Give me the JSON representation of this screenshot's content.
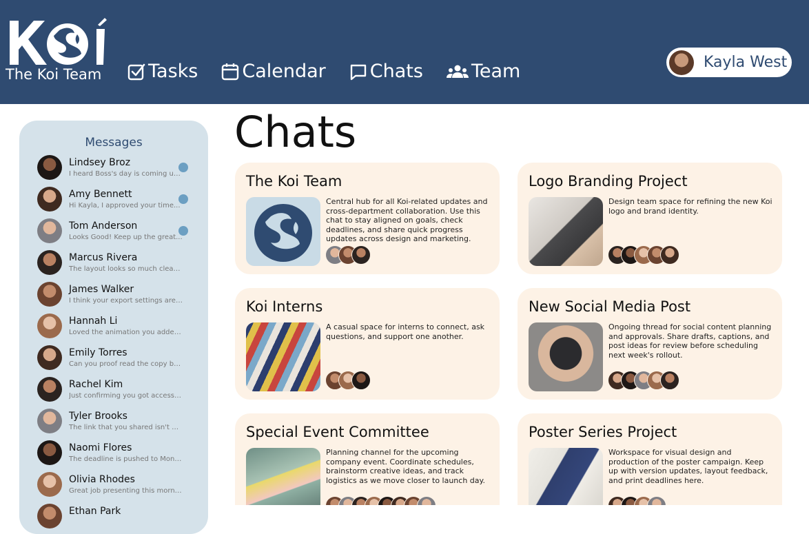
{
  "brand": {
    "name": "The Koi Team"
  },
  "nav": {
    "items": [
      {
        "label": "Tasks",
        "icon": "check-square-icon"
      },
      {
        "label": "Calendar",
        "icon": "calendar-icon"
      },
      {
        "label": "Chats",
        "icon": "chat-bubble-icon"
      },
      {
        "label": "Team",
        "icon": "team-icon"
      }
    ]
  },
  "user": {
    "name": "Kayla West"
  },
  "colors": {
    "header": "#2f4b71",
    "sidebar": "#d5e2ea",
    "card": "#fdf2e6",
    "unread_dot": "#6c9fc2"
  },
  "sidebar": {
    "title": "Messages",
    "messages": [
      {
        "name": "Lindsey Broz",
        "preview": "I heard Boss's day is coming up...",
        "unread": true
      },
      {
        "name": "Amy Bennett",
        "preview": "Hi Kayla, I approved your time...",
        "unread": true
      },
      {
        "name": "Tom Anderson",
        "preview": "Looks Good! Keep up the great...",
        "unread": true
      },
      {
        "name": "Marcus Rivera",
        "preview": "The layout looks so much cleaner...",
        "unread": false
      },
      {
        "name": "James Walker",
        "preview": "I think your export settings are cro...",
        "unread": false
      },
      {
        "name": "Hannah Li",
        "preview": "Loved the animation you added to...",
        "unread": false
      },
      {
        "name": "Emily Torres",
        "preview": "Can you proof read the copy befo...",
        "unread": false
      },
      {
        "name": "Rachel Kim",
        "preview": "Just confirming you got access to...",
        "unread": false
      },
      {
        "name": "Tyler Brooks",
        "preview": "The link that you shared isn't work...",
        "unread": false
      },
      {
        "name": "Naomi Flores",
        "preview": "The deadline is pushed to Monday...",
        "unread": false
      },
      {
        "name": "Olivia Rhodes",
        "preview": "Great job presenting this morning...",
        "unread": false
      },
      {
        "name": "Ethan Park",
        "preview": "",
        "unread": false
      }
    ]
  },
  "main": {
    "title": "Chats",
    "chats": [
      {
        "title": "The Koi Team",
        "description": "Central hub for all Koi-related updates and cross-department collaboration. Use this chat to stay aligned on goals, check deadlines, and share quick progress updates across design and marketing.",
        "member_count": 3
      },
      {
        "title": "Logo Branding Project",
        "description": "Design team space for refining the new Koi logo and brand identity.",
        "member_count": 5
      },
      {
        "title": "Koi Interns",
        "description": "A casual space for interns to connect, ask questions, and support one another.",
        "member_count": 3
      },
      {
        "title": "New Social Media Post",
        "description": "Ongoing thread for social content planning and approvals. Share drafts, captions, and post ideas for review before scheduling next week's rollout.",
        "member_count": 5
      },
      {
        "title": "Special Event Committee",
        "description": "Planning channel for the upcoming company event. Coordinate schedules, brainstorm creative ideas, and track logistics as we move closer to launch day.",
        "member_count": 8
      },
      {
        "title": "Poster Series Project",
        "description": "Workspace for visual design and production of the poster campaign. Keep up with version updates, layout feedback, and print deadlines here.",
        "member_count": 4
      }
    ]
  }
}
